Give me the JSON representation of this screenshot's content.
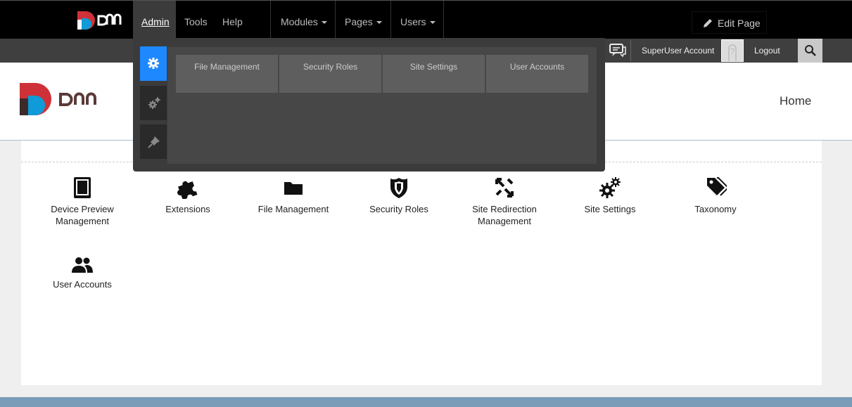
{
  "controlbar": {
    "menus": [
      {
        "label": "Admin",
        "active": true
      },
      {
        "label": "Tools"
      },
      {
        "label": "Help"
      },
      {
        "label": "Modules",
        "dropdown": true
      },
      {
        "label": "Pages",
        "dropdown": true
      },
      {
        "label": "Users",
        "dropdown": true
      }
    ],
    "edit_page_label": "Edit Page",
    "logo_icon": "dnn-logo-icon"
  },
  "userbar": {
    "messages_icon": "chat-bubbles-icon",
    "user_name": "SuperUser Account",
    "logout_label": "Logout",
    "search_icon": "search-icon"
  },
  "header": {
    "logo": "DNN",
    "nav": {
      "home_label": "Home"
    }
  },
  "admin_dropdown": {
    "side_tabs": [
      {
        "icon": "gear-icon",
        "active": true
      },
      {
        "icon": "gears-icon"
      },
      {
        "icon": "pin-icon"
      }
    ],
    "items": [
      {
        "label": "File Management"
      },
      {
        "label": "Security Roles"
      },
      {
        "label": "Site Settings"
      },
      {
        "label": "User Accounts"
      }
    ]
  },
  "console": {
    "items": [
      {
        "label": "Device Preview\nManagement",
        "icon": "tablet-icon"
      },
      {
        "label": "Extensions",
        "icon": "puzzle-icon"
      },
      {
        "label": "File Management",
        "icon": "folder-icon"
      },
      {
        "label": "Security Roles",
        "icon": "shield-icon"
      },
      {
        "label": "Site Redirection\nManagement",
        "icon": "redirect-arrows-icon"
      },
      {
        "label": "Site Settings",
        "icon": "gears-icon"
      },
      {
        "label": "Taxonomy",
        "icon": "tags-icon"
      },
      {
        "label": "User Accounts",
        "icon": "users-icon"
      }
    ]
  },
  "colors": {
    "controlbar_bg": "#000000",
    "userbar_bg": "#3f3f3f",
    "accent_blue": "#1e88ff",
    "dnn_red": "#ce3238",
    "dnn_blue": "#0f9bd7",
    "footer_strip": "#7b9cb8"
  }
}
